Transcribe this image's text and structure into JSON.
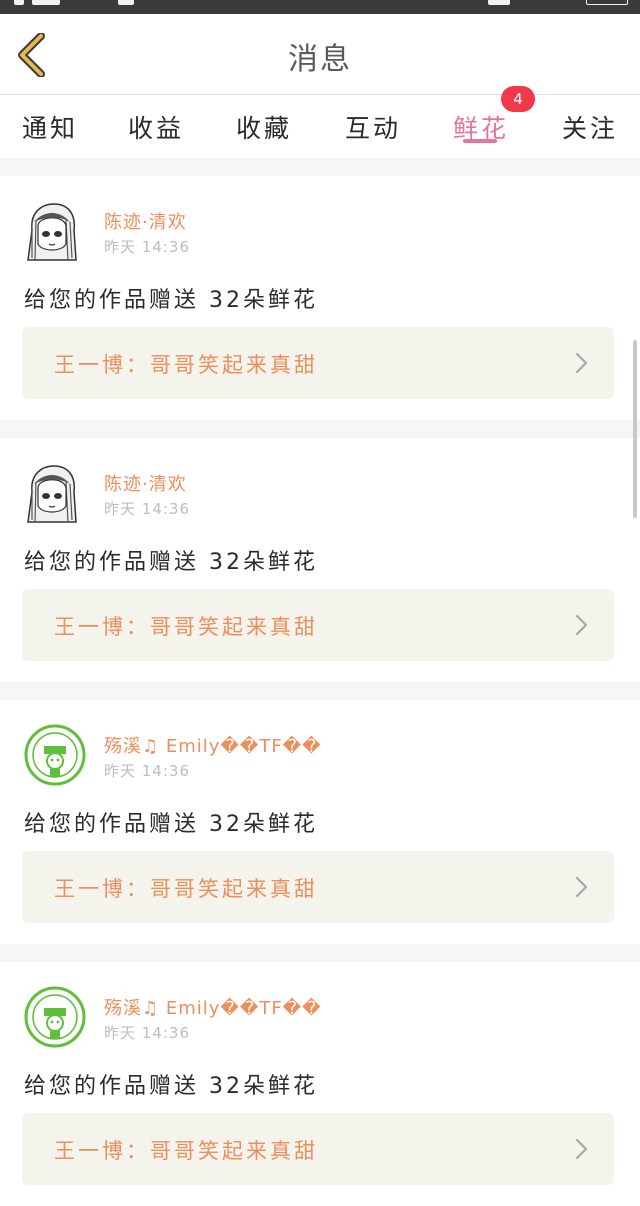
{
  "header": {
    "title": "消息",
    "back_icon": "chevron-left-icon",
    "accent_color": "#e8b84a"
  },
  "tabs": [
    {
      "label": "通知"
    },
    {
      "label": "收益"
    },
    {
      "label": "收藏"
    },
    {
      "label": "互动"
    },
    {
      "label": "鲜花",
      "active": true,
      "badge": "4"
    },
    {
      "label": "关注"
    }
  ],
  "colors": {
    "active_tab": "#e8739c",
    "badge": "#f2384b",
    "user_name": "#ec8f5c",
    "link_background": "#f4f3ec"
  },
  "notifications": [
    {
      "user": "陈迹·清欢",
      "time": "昨天 14:36",
      "avatar_icon": "sketch-girl-avatar-icon",
      "message": "给您的作品赠送 32朵鲜花",
      "work": "王一博：哥哥笑起来真甜",
      "chevron_icon": "chevron-right-icon"
    },
    {
      "user": "陈迹·清欢",
      "time": "昨天 14:36",
      "avatar_icon": "sketch-girl-avatar-icon",
      "message": "给您的作品赠送 32朵鲜花",
      "work": "王一博：哥哥笑起来真甜",
      "chevron_icon": "chevron-right-icon"
    },
    {
      "user": "殇溪♫ Emily��TF��",
      "time": "昨天 14:36",
      "avatar_icon": "green-stamp-avatar-icon",
      "message": "给您的作品赠送 32朵鲜花",
      "work": "王一博：哥哥笑起来真甜",
      "chevron_icon": "chevron-right-icon"
    },
    {
      "user": "殇溪♫ Emily��TF��",
      "time": "昨天 14:36",
      "avatar_icon": "green-stamp-avatar-icon",
      "message": "给您的作品赠送 32朵鲜花",
      "work": "王一博：哥哥笑起来真甜",
      "chevron_icon": "chevron-right-icon"
    }
  ]
}
